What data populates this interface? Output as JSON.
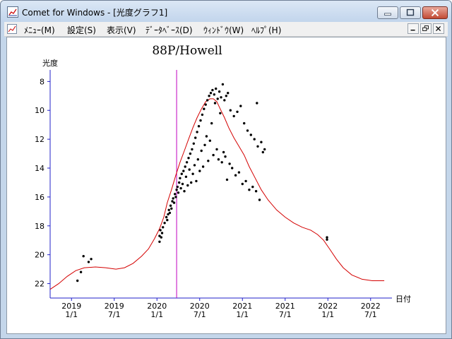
{
  "window": {
    "title": "Comet for Windows - [光度グラフ1]",
    "icon": "graph-document-icon",
    "controls": [
      "minimize-icon",
      "maximize-icon",
      "close-icon"
    ]
  },
  "menu": {
    "items": [
      "ﾒﾆｭｰ(M)",
      "設定(S)",
      "表示(V)",
      "ﾃﾞｰﾀﾍﾞｰｽ(D)",
      "ｳｨﾝﾄﾞｳ(W)",
      "ﾍﾙﾌﾟ(H)"
    ],
    "mdi_controls": [
      "mdi-minimize-icon",
      "mdi-restore-icon",
      "mdi-close-icon"
    ]
  },
  "colors": {
    "axis": "#2020c8",
    "curve": "#d40000",
    "marker": "#c000c0",
    "points": "#000000"
  },
  "chart_data": {
    "type": "scatter",
    "title": "88P/Howell",
    "ylabel": "光度",
    "xlabel": "日付",
    "y_inverted": true,
    "x_unit": "decimal year",
    "xlim": [
      2018.75,
      2022.75
    ],
    "ylim": [
      23,
      7.2
    ],
    "y_ticks": [
      8,
      10,
      12,
      14,
      16,
      18,
      20,
      22
    ],
    "x_ticks": [
      {
        "x": 2019.0,
        "top": "2019",
        "bottom": "1/1"
      },
      {
        "x": 2019.5,
        "top": "2019",
        "bottom": "7/1"
      },
      {
        "x": 2020.0,
        "top": "2020",
        "bottom": "1/1"
      },
      {
        "x": 2020.5,
        "top": "2020",
        "bottom": "7/1"
      },
      {
        "x": 2021.0,
        "top": "2021",
        "bottom": "1/1"
      },
      {
        "x": 2021.5,
        "top": "2021",
        "bottom": "7/1"
      },
      {
        "x": 2022.0,
        "top": "2022",
        "bottom": "1/1"
      },
      {
        "x": 2022.5,
        "top": "2022",
        "bottom": "7/1"
      }
    ],
    "marker_x": 2020.23,
    "grid": false,
    "series": [
      {
        "type": "line",
        "points": [
          [
            2018.75,
            22.4
          ],
          [
            2018.85,
            22.0
          ],
          [
            2018.95,
            21.5
          ],
          [
            2019.05,
            21.1
          ],
          [
            2019.15,
            20.9
          ],
          [
            2019.28,
            20.85
          ],
          [
            2019.4,
            20.9
          ],
          [
            2019.52,
            21.0
          ],
          [
            2019.62,
            20.9
          ],
          [
            2019.72,
            20.6
          ],
          [
            2019.82,
            20.1
          ],
          [
            2019.9,
            19.6
          ],
          [
            2019.97,
            18.9
          ],
          [
            2020.03,
            18.2
          ],
          [
            2020.08,
            17.4
          ],
          [
            2020.12,
            16.4
          ],
          [
            2020.17,
            15.5
          ],
          [
            2020.22,
            14.5
          ],
          [
            2020.27,
            13.6
          ],
          [
            2020.32,
            12.8
          ],
          [
            2020.37,
            12.0
          ],
          [
            2020.42,
            11.2
          ],
          [
            2020.47,
            10.5
          ],
          [
            2020.52,
            9.9
          ],
          [
            2020.57,
            9.4
          ],
          [
            2020.62,
            9.2
          ],
          [
            2020.66,
            9.2
          ],
          [
            2020.7,
            9.4
          ],
          [
            2020.74,
            9.9
          ],
          [
            2020.79,
            10.5
          ],
          [
            2020.84,
            11.2
          ],
          [
            2020.9,
            11.9
          ],
          [
            2020.96,
            12.5
          ],
          [
            2021.02,
            13.1
          ],
          [
            2021.08,
            13.9
          ],
          [
            2021.15,
            14.7
          ],
          [
            2021.22,
            15.5
          ],
          [
            2021.3,
            16.2
          ],
          [
            2021.4,
            16.9
          ],
          [
            2021.5,
            17.4
          ],
          [
            2021.6,
            17.8
          ],
          [
            2021.7,
            18.1
          ],
          [
            2021.8,
            18.3
          ],
          [
            2021.88,
            18.6
          ],
          [
            2021.95,
            19.0
          ],
          [
            2022.02,
            19.6
          ],
          [
            2022.1,
            20.3
          ],
          [
            2022.18,
            20.9
          ],
          [
            2022.28,
            21.4
          ],
          [
            2022.4,
            21.7
          ],
          [
            2022.52,
            21.8
          ],
          [
            2022.66,
            21.8
          ]
        ]
      },
      {
        "type": "scatter",
        "points": [
          [
            2019.07,
            21.8
          ],
          [
            2019.11,
            21.2
          ],
          [
            2019.14,
            20.1
          ],
          [
            2019.2,
            20.5
          ],
          [
            2019.23,
            20.3
          ],
          [
            2020.03,
            19.1
          ],
          [
            2020.03,
            18.7
          ],
          [
            2020.04,
            18.3
          ],
          [
            2020.05,
            18.8
          ],
          [
            2020.06,
            18.5
          ],
          [
            2020.07,
            18.1
          ],
          [
            2020.09,
            17.8
          ],
          [
            2020.11,
            17.4
          ],
          [
            2020.12,
            17.6
          ],
          [
            2020.13,
            17.2
          ],
          [
            2020.14,
            16.9
          ],
          [
            2020.15,
            17.1
          ],
          [
            2020.16,
            16.6
          ],
          [
            2020.17,
            16.8
          ],
          [
            2020.18,
            16.3
          ],
          [
            2020.19,
            16.1
          ],
          [
            2020.2,
            16.4
          ],
          [
            2020.21,
            15.8
          ],
          [
            2020.22,
            16.0
          ],
          [
            2020.23,
            15.5
          ],
          [
            2020.24,
            15.3
          ],
          [
            2020.25,
            15.7
          ],
          [
            2020.26,
            15.0
          ],
          [
            2020.27,
            14.7
          ],
          [
            2020.28,
            15.4
          ],
          [
            2020.29,
            14.4
          ],
          [
            2020.3,
            15.1
          ],
          [
            2020.31,
            14.2
          ],
          [
            2020.32,
            15.6
          ],
          [
            2020.33,
            13.9
          ],
          [
            2020.34,
            14.6
          ],
          [
            2020.35,
            13.6
          ],
          [
            2020.36,
            15.2
          ],
          [
            2020.37,
            13.3
          ],
          [
            2020.38,
            14.1
          ],
          [
            2020.39,
            13.0
          ],
          [
            2020.4,
            15.0
          ],
          [
            2020.41,
            12.7
          ],
          [
            2020.42,
            14.4
          ],
          [
            2020.43,
            12.3
          ],
          [
            2020.44,
            13.8
          ],
          [
            2020.45,
            11.9
          ],
          [
            2020.46,
            14.9
          ],
          [
            2020.47,
            11.5
          ],
          [
            2020.48,
            13.4
          ],
          [
            2020.49,
            11.1
          ],
          [
            2020.5,
            14.2
          ],
          [
            2020.51,
            10.7
          ],
          [
            2020.52,
            12.8
          ],
          [
            2020.53,
            10.3
          ],
          [
            2020.54,
            13.9
          ],
          [
            2020.55,
            9.9
          ],
          [
            2020.56,
            12.4
          ],
          [
            2020.57,
            9.6
          ],
          [
            2020.58,
            11.8
          ],
          [
            2020.59,
            9.3
          ],
          [
            2020.6,
            13.5
          ],
          [
            2020.61,
            9.0
          ],
          [
            2020.62,
            12.1
          ],
          [
            2020.63,
            8.8
          ],
          [
            2020.64,
            10.9
          ],
          [
            2020.65,
            8.6
          ],
          [
            2020.66,
            13.1
          ],
          [
            2020.67,
            8.9
          ],
          [
            2020.68,
            9.5
          ],
          [
            2020.69,
            8.5
          ],
          [
            2020.7,
            12.7
          ],
          [
            2020.71,
            9.2
          ],
          [
            2020.72,
            13.4
          ],
          [
            2020.73,
            8.7
          ],
          [
            2020.74,
            10.2
          ],
          [
            2020.75,
            9.1
          ],
          [
            2020.76,
            13.6
          ],
          [
            2020.77,
            8.2
          ],
          [
            2020.78,
            12.9
          ],
          [
            2020.79,
            9.3
          ],
          [
            2020.8,
            13.2
          ],
          [
            2020.81,
            9.0
          ],
          [
            2020.82,
            14.8
          ],
          [
            2020.83,
            8.8
          ],
          [
            2020.85,
            13.7
          ],
          [
            2020.86,
            10.0
          ],
          [
            2020.88,
            14.0
          ],
          [
            2020.9,
            10.4
          ],
          [
            2020.92,
            14.5
          ],
          [
            2020.94,
            10.1
          ],
          [
            2020.96,
            14.3
          ],
          [
            2020.98,
            9.7
          ],
          [
            2021.0,
            15.1
          ],
          [
            2021.02,
            10.9
          ],
          [
            2021.04,
            14.9
          ],
          [
            2021.06,
            11.4
          ],
          [
            2021.08,
            15.5
          ],
          [
            2021.1,
            11.7
          ],
          [
            2021.12,
            15.3
          ],
          [
            2021.14,
            12.0
          ],
          [
            2021.16,
            15.6
          ],
          [
            2021.17,
            9.5
          ],
          [
            2021.18,
            12.5
          ],
          [
            2021.2,
            16.2
          ],
          [
            2021.22,
            12.2
          ],
          [
            2021.24,
            12.9
          ],
          [
            2021.26,
            12.7
          ],
          [
            2021.99,
            18.8
          ],
          [
            2021.99,
            18.95
          ]
        ]
      }
    ]
  }
}
